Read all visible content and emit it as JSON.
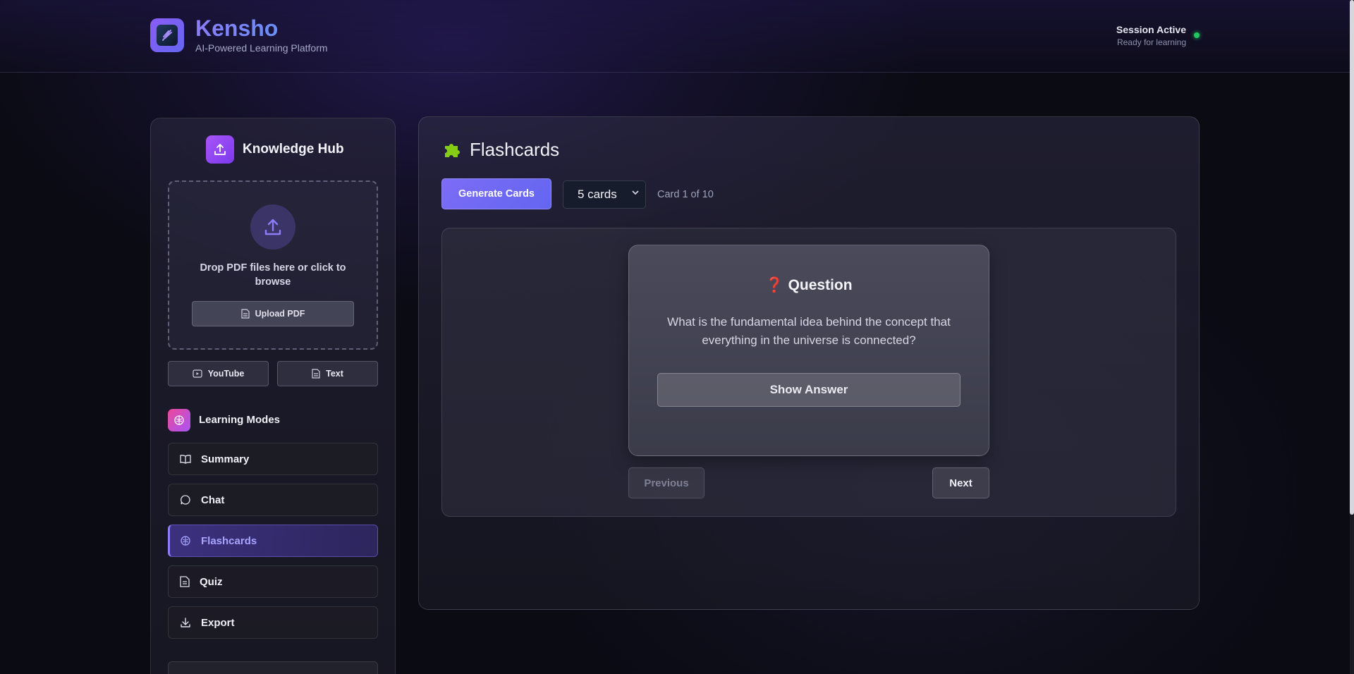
{
  "app": {
    "name": "Kensho",
    "tagline": "AI-Powered Learning Platform",
    "brand_colors": [
      "#8b7cf8",
      "#6a8ef7"
    ]
  },
  "session": {
    "title": "Session Active",
    "subtitle": "Ready for learning",
    "status_color": "#22c55e"
  },
  "sidebar": {
    "hub_title": "Knowledge Hub",
    "dropzone_text": "Drop PDF files here or click to browse",
    "upload_label": "Upload PDF",
    "sources": [
      {
        "label": "YouTube",
        "icon": "youtube-icon"
      },
      {
        "label": "Text",
        "icon": "document-icon"
      }
    ],
    "modes_title": "Learning Modes",
    "modes": [
      {
        "label": "Summary",
        "icon": "book-icon",
        "active": false
      },
      {
        "label": "Chat",
        "icon": "chat-bubble-icon",
        "active": false
      },
      {
        "label": "Flashcards",
        "icon": "brain-icon",
        "active": true
      },
      {
        "label": "Quiz",
        "icon": "document-icon",
        "active": false
      },
      {
        "label": "Export",
        "icon": "download-icon",
        "active": false
      }
    ]
  },
  "main": {
    "title": "Flashcards",
    "title_icon": "puzzle-icon",
    "generate_label": "Generate Cards",
    "card_count_select": {
      "value": "5 cards"
    },
    "card_position": "Card 1 of 10",
    "card": {
      "heading": "Question",
      "question": "What is the fundamental idea behind the concept that everything in the universe is connected?",
      "show_answer_label": "Show Answer"
    },
    "previous_label": "Previous",
    "next_label": "Next"
  }
}
